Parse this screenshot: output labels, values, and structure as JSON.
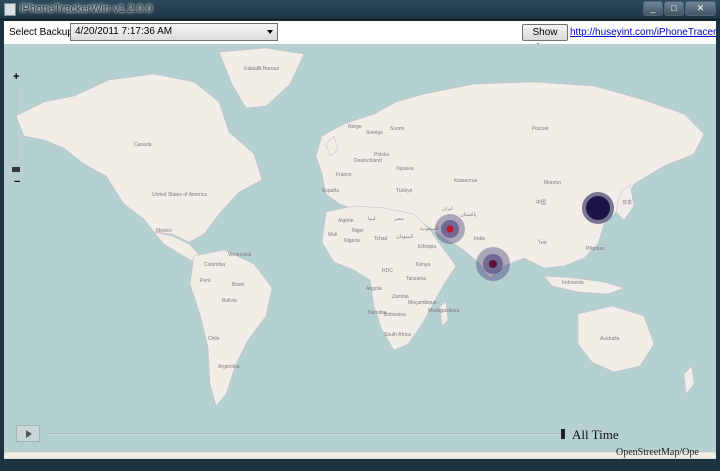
{
  "window": {
    "title": "iPhoneTrackerWin v1.2.0.0",
    "minimize_glyph": "_",
    "maximize_glyph": "□",
    "close_glyph": "✕"
  },
  "toolbar": {
    "select_label": "Select Backup:",
    "backup_value": "4/20/2011 7:17:36 AM",
    "show_log_label": "Show Log",
    "link_text": "http://huseyint.com/iPhoneTracerkWin"
  },
  "map": {
    "zoom_in": "+",
    "zoom_out": "−",
    "time_label": "All Time",
    "attribution": "OpenStreetMap/Ope",
    "water_color": "#b5d0d0",
    "land_color": "#f1eee8",
    "marker_color": "#1a1155",
    "marker_center_color": "#c0152a",
    "labels": {
      "russia": "Россия",
      "canada": "Canada",
      "usa": "United States of America",
      "brasil": "Brasil",
      "china": "中国",
      "india": "India",
      "australia": "Australia",
      "kazakhstan": "Казахстан",
      "mongolia": "Монгол",
      "greenland": "Kalaallit Nunaat",
      "nigeria": "Nigeria",
      "kenya": "Kenya",
      "south_africa": "South Africa",
      "argentina": "Argentina",
      "mexico": "Mexico",
      "madagascar": "Madagasikara",
      "indonesia": "Indonesia",
      "iran": "ایران",
      "peru": "Perú",
      "bolivia": "Bolivia",
      "colombia": "Colombia",
      "venezuela": "Venezuela",
      "chile": "Chile",
      "algeria": "Algérie",
      "libya": "ليبيا",
      "egypt": "مصر",
      "sudan": "السودان",
      "ethiopia": "Ethiopia",
      "angola": "Angola",
      "mali": "Mali",
      "niger": "Niger",
      "chad": "Tchad",
      "drc": "RDC",
      "tanzania": "Tanzania",
      "zambia": "Zambia",
      "namibia": "Namibia",
      "botswana": "Botswana",
      "mozambique": "Moçambique",
      "saudi": "السعودية",
      "pakistan": "پاکستان",
      "turkey": "Türkiye",
      "japan": "日本",
      "thailand": "ไทย",
      "philippines": "Pilipinas",
      "ukraine": "Україна",
      "france": "France",
      "spain": "España",
      "germany": "Deutschland",
      "poland": "Polska",
      "finland": "Suomi",
      "sweden": "Sverige",
      "norway": "Norge"
    }
  }
}
